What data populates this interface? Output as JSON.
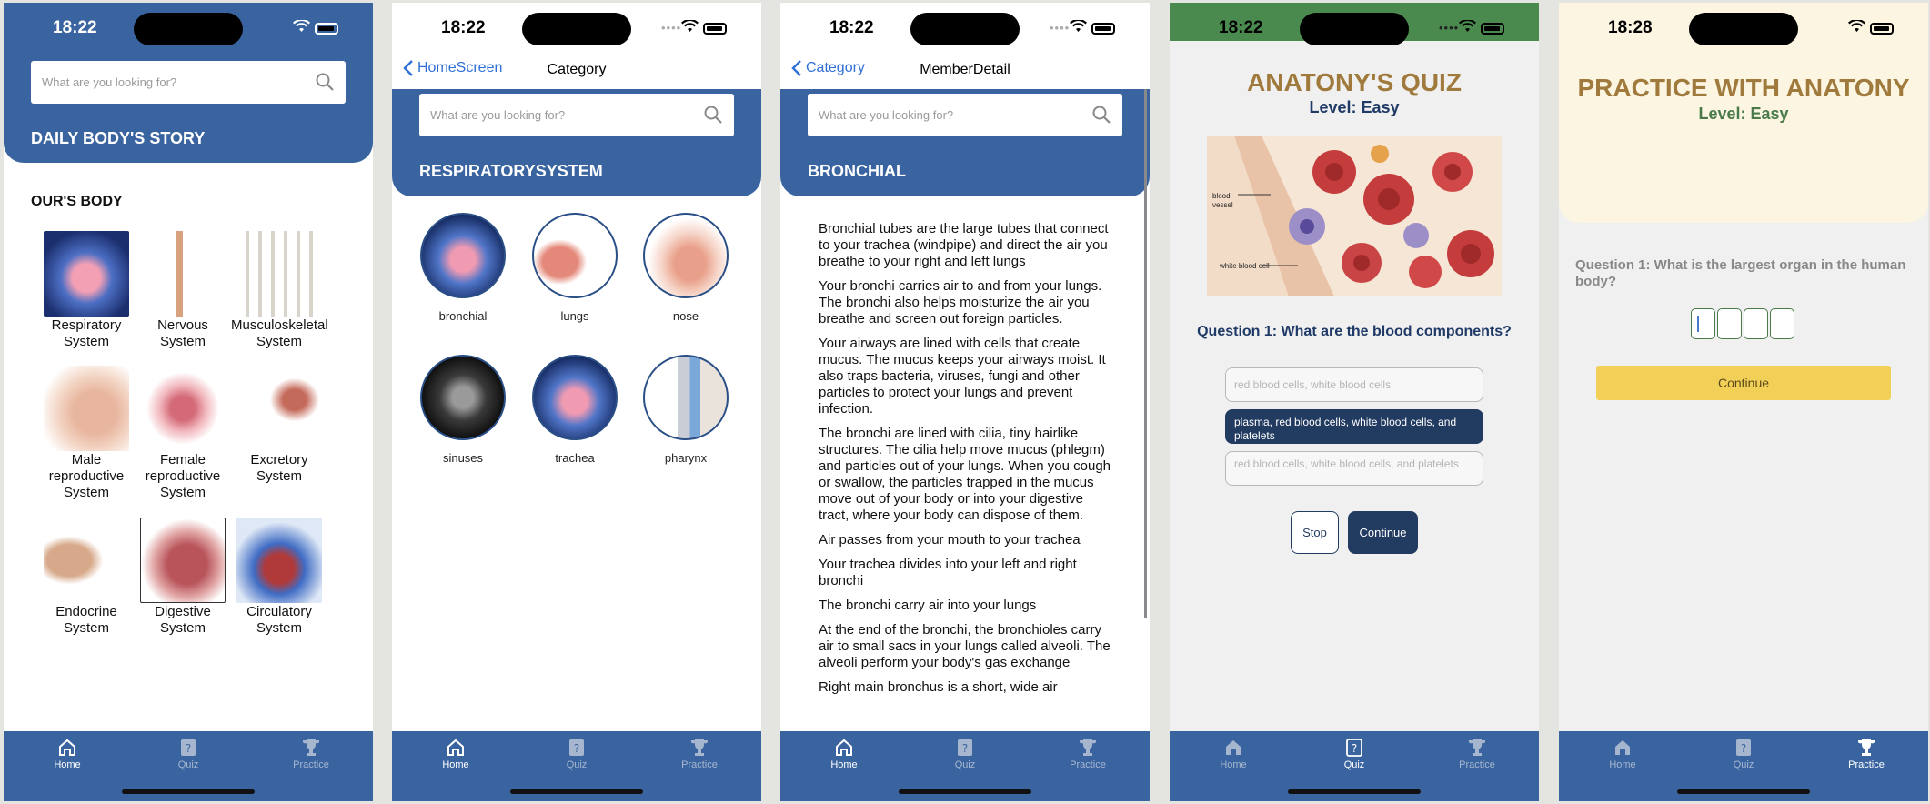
{
  "screens": [
    {
      "time": "18:22",
      "search_placeholder": "What are you looking for?",
      "header_title": "DAILY BODY'S STORY",
      "section_title": "OUR'S BODY",
      "systems": [
        {
          "label": "Respiratory System",
          "icon": "respiratory-image"
        },
        {
          "label": "Nervous System",
          "icon": "nervous-image"
        },
        {
          "label": "Musculoskeletal System",
          "icon": "skeleton-image"
        },
        {
          "label": "Male reproductive System",
          "icon": "male-reproductive-image"
        },
        {
          "label": "Female reproductive System",
          "icon": "female-reproductive-image"
        },
        {
          "label": "Excretory System",
          "icon": "excretory-image"
        },
        {
          "label": "Endocrine System",
          "icon": "endocrine-image"
        },
        {
          "label": "Digestive System",
          "icon": "stomach-image"
        },
        {
          "label": "Circulatory System",
          "icon": "heart-image"
        }
      ]
    },
    {
      "time": "18:22",
      "back_label": "HomeScreen",
      "nav_title": "Category",
      "search_placeholder": "What are you looking for?",
      "header_title": "RESPIRATORYSYSTEM",
      "members": [
        {
          "label": "bronchial"
        },
        {
          "label": "lungs"
        },
        {
          "label": "nose"
        },
        {
          "label": "sinuses"
        },
        {
          "label": "trachea"
        },
        {
          "label": "pharynx"
        }
      ]
    },
    {
      "time": "18:22",
      "back_label": "Category",
      "nav_title": "MemberDetail",
      "search_placeholder": "What are you looking for?",
      "header_title": "BRONCHIAL",
      "paragraphs": [
        "Bronchial tubes are the large tubes that connect to your trachea (windpipe) and direct the air you breathe to your right and left lungs",
        "Your bronchi carries air to and from your lungs. The bronchi also helps moisturize the air you breathe and screen out foreign particles.",
        "Your airways are lined with cells that create mucus. The mucus keeps your airways moist. It also traps bacteria, viruses, fungi and other particles to protect your lungs and prevent infection.",
        "The bronchi are lined with cilia, tiny hairlike structures. The cilia help move mucus (phlegm) and particles out of your lungs. When you cough or swallow, the particles trapped in the mucus move out of your body or into your digestive tract, where your body can dispose of them.",
        "Air passes from your mouth to your trachea",
        "Your trachea divides into your left and right bronchi",
        "The bronchi carry air into your lungs",
        "At the end of the bronchi, the bronchioles carry air to small sacs in your lungs called alveoli. The alveoli perform your body's gas exchange",
        "Right main bronchus is a short, wide air"
      ]
    },
    {
      "time": "18:22",
      "title": "ANATONY'S QUIZ",
      "level": "Level: Easy",
      "image_labels": [
        "blood vessel",
        "white blood cell"
      ],
      "question": "Question 1: What are the blood components?",
      "options": [
        "red blood cells, white blood cells",
        "plasma, red blood cells, white blood cells, and platelets",
        "red blood cells, white blood cells, and platelets"
      ],
      "selected_option": 1,
      "stop_label": "Stop",
      "continue_label": "Continue"
    },
    {
      "time": "18:28",
      "title": "PRACTICE WITH ANATONY",
      "level": "Level: Easy",
      "question": "Question 1: What is the largest organ in the human body?",
      "answer_boxes": 4,
      "continue_label": "Continue"
    }
  ],
  "tabs": [
    "Home",
    "Quiz",
    "Practice"
  ],
  "active_tabs": [
    "Home",
    "Home",
    "Home",
    "Quiz",
    "Practice"
  ],
  "colors": {
    "primary_blue": "#3a64a0",
    "dark_navy": "#223b61",
    "gold_title": "#a07a3c",
    "green_level": "#4b7a4a",
    "quiz_status_green": "#4a8a4e",
    "practice_cream": "#fbf5e1",
    "continue_yellow": "#f2cf57",
    "link_blue": "#2f6fd6"
  }
}
